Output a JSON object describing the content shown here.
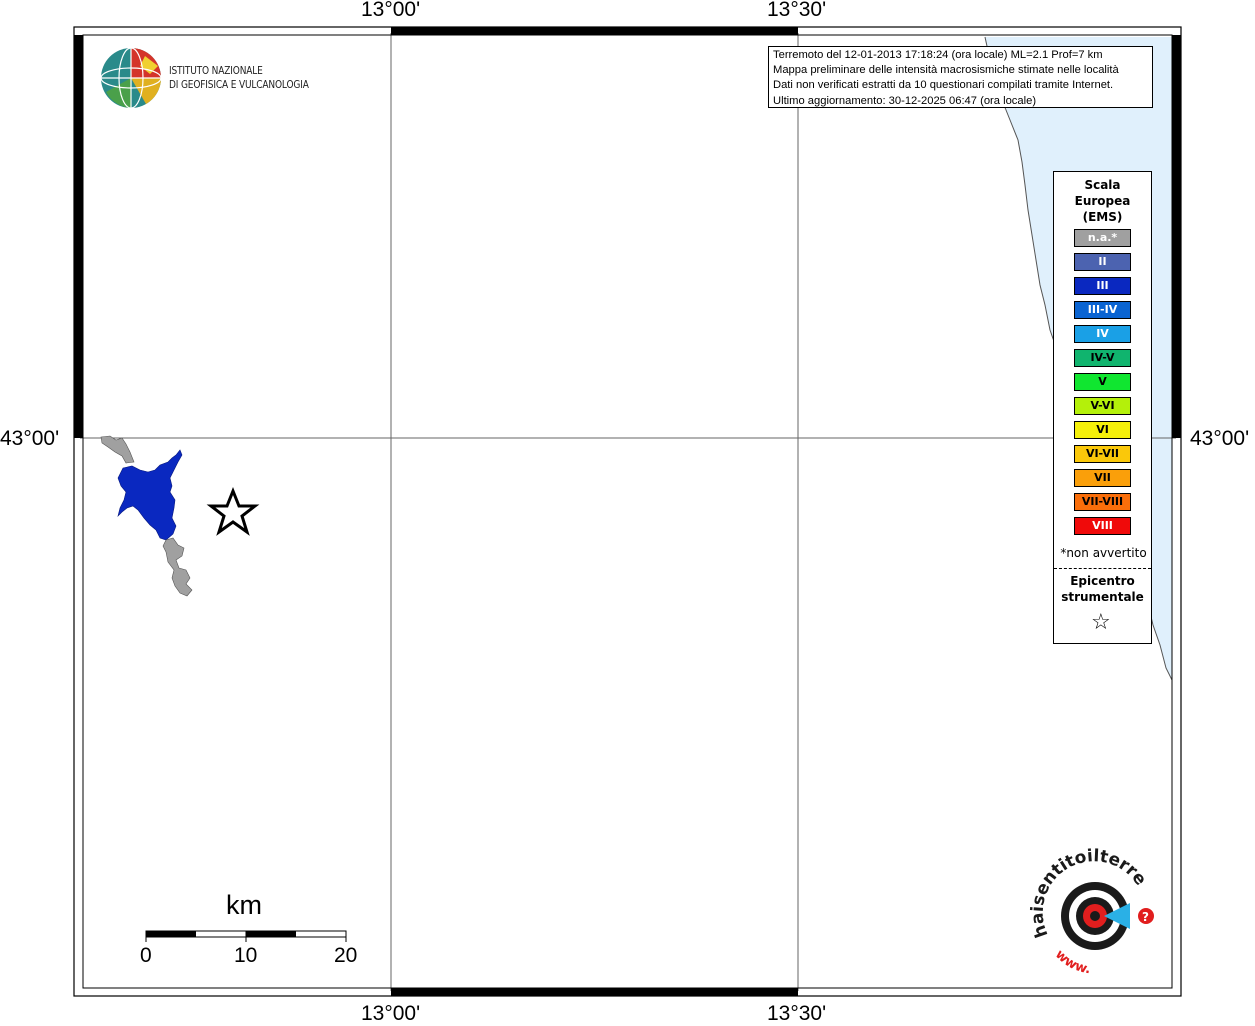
{
  "map": {
    "coords": {
      "lon_left": "13°00'",
      "lon_right": "13°30'",
      "lat_mid": "43°00'"
    },
    "info_box": {
      "line1": "Terremoto del 12-01-2013 17:18:24 (ora locale) ML=2.1 Prof=7 km",
      "line2": "Mappa preliminare delle intensità macrosismiche stimate nelle località",
      "line3": "Dati non verificati estratti da 10 questionari compilati tramite Internet.",
      "line4": "Ultimo aggiornamento: 30-12-2025 06:47 (ora locale)"
    },
    "logo": {
      "line1": "ISTITUTO NAZIONALE",
      "line2": "DI GEOFISICA E VULCANOLOGIA",
      "icon": "ingv-globe-logo"
    },
    "legend": {
      "title1": "Scala",
      "title2": "Europea",
      "title3": "(EMS)",
      "classes": [
        {
          "label": "n.a.*",
          "color": "#a0a0a0"
        },
        {
          "label": "II",
          "color": "#4c63b0"
        },
        {
          "label": "III",
          "color": "#0a28c0"
        },
        {
          "label": "III-IV",
          "color": "#0a64d2"
        },
        {
          "label": "IV",
          "color": "#1aa0e6"
        },
        {
          "label": "IV-V",
          "color": "#10b46e"
        },
        {
          "label": "V",
          "color": "#10e630"
        },
        {
          "label": "V-VI",
          "color": "#b4f00a"
        },
        {
          "label": "VI",
          "color": "#f5f00a"
        },
        {
          "label": "VI-VII",
          "color": "#fac80a"
        },
        {
          "label": "VII",
          "color": "#fa9f0a"
        },
        {
          "label": "VII-VIII",
          "color": "#fa6e0a"
        },
        {
          "label": "VIII",
          "color": "#f00a0a"
        }
      ],
      "not_felt": "*non avvertito",
      "epicenter1": "Epicentro",
      "epicenter2": "strumentale",
      "epicenter_icon": "star-outline-icon"
    },
    "scale_bar": {
      "unit": "km",
      "ticks": [
        "0",
        "10",
        "20"
      ]
    },
    "colors": {
      "sea": "#e0f0fc",
      "intensity_III": "#0a28c0",
      "not_available": "#a0a0a0"
    },
    "watermark": {
      "text": "haisentitoilterremoto.it",
      "prefix": "www."
    }
  }
}
